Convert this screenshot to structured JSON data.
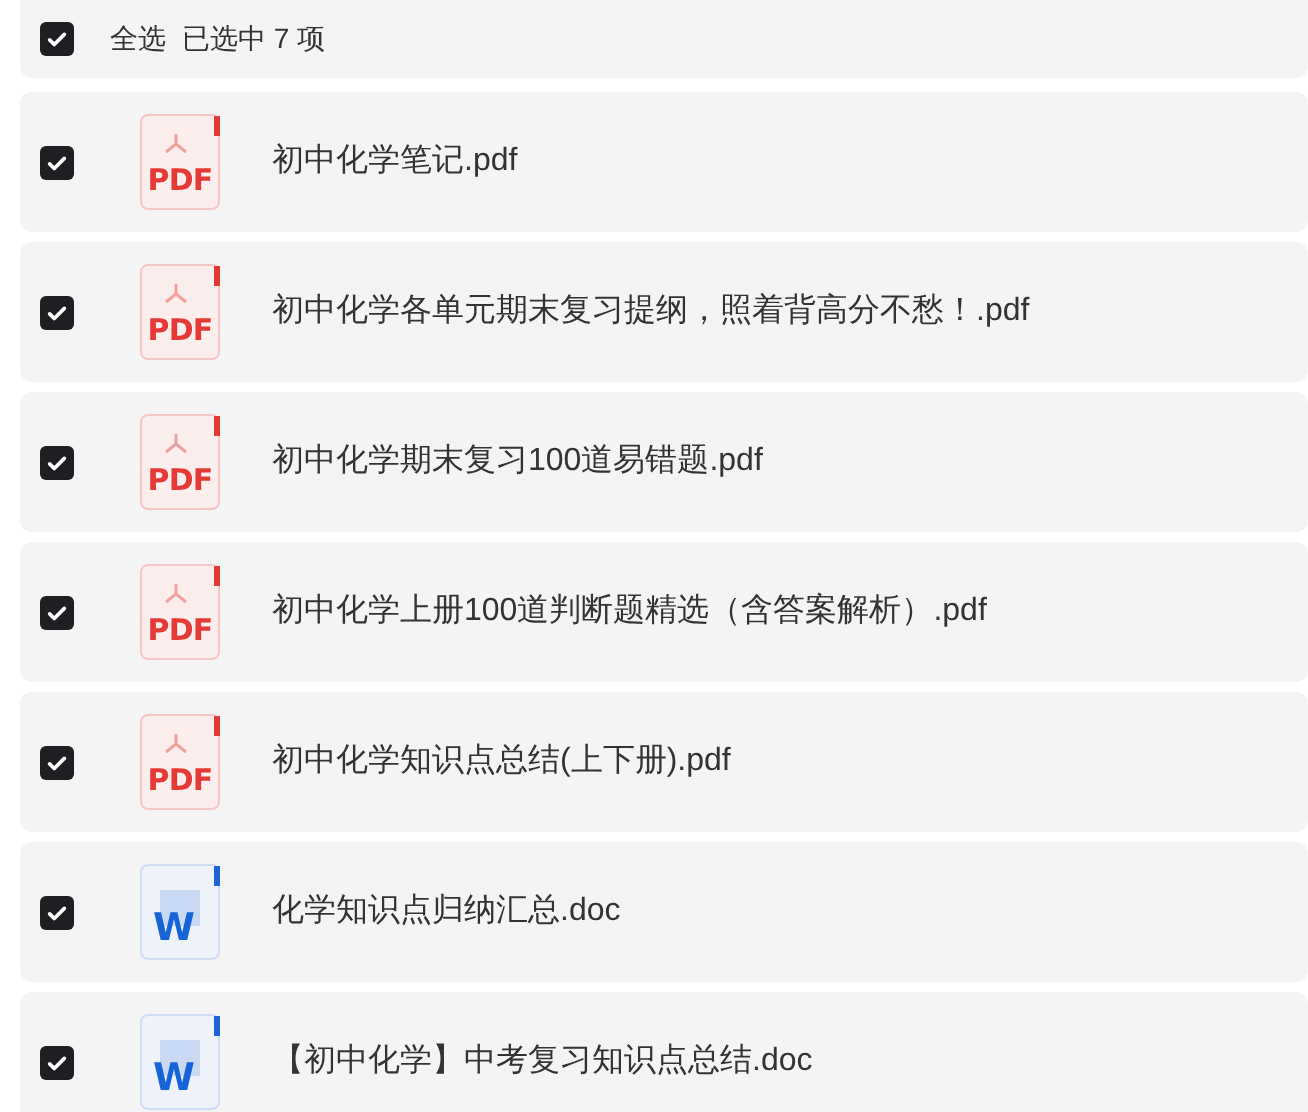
{
  "header": {
    "checked": true,
    "label": "全选",
    "summary": "已选中 7 项"
  },
  "files": [
    {
      "name": "初中化学笔记.pdf",
      "kind": "pdf",
      "icon_label": "PDF",
      "checked": true
    },
    {
      "name": "初中化学各单元期末复习提纲，照着背高分不愁！.pdf",
      "kind": "pdf",
      "icon_label": "PDF",
      "checked": true
    },
    {
      "name": "初中化学期末复习100道易错题.pdf",
      "kind": "pdf",
      "icon_label": "PDF",
      "checked": true
    },
    {
      "name": "初中化学上册100道判断题精选（含答案解析）.pdf",
      "kind": "pdf",
      "icon_label": "PDF",
      "checked": true
    },
    {
      "name": "初中化学知识点总结(上下册).pdf",
      "kind": "pdf",
      "icon_label": "PDF",
      "checked": true
    },
    {
      "name": "化学知识点归纳汇总.doc",
      "kind": "doc",
      "icon_label": "W",
      "checked": true
    },
    {
      "name": "【初中化学】中考复习知识点总结.doc",
      "kind": "doc",
      "icon_label": "W",
      "checked": true
    }
  ]
}
